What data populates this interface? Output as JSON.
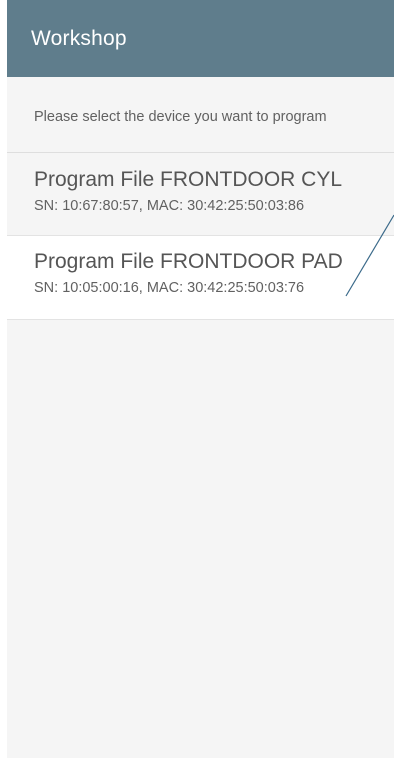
{
  "appbar": {
    "title": "Workshop",
    "color": "#5f7d8c"
  },
  "instruction": "Please select the device you want to program",
  "devices": [
    {
      "title": "Program File FRONTDOOR CYL",
      "subtitle": "SN: 10:67:80:57, MAC: 30:42:25:50:03:86"
    },
    {
      "title": "Program File FRONTDOOR PAD",
      "subtitle": "SN: 10:05:00:16, MAC: 30:42:25:50:03:76"
    }
  ],
  "annotation_color": "#3b6a8a"
}
